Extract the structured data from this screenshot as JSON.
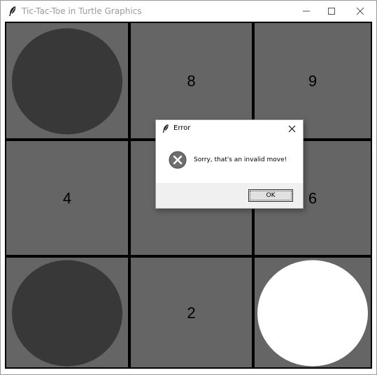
{
  "window": {
    "title": "Tic-Tac-Toe in Turtle Graphics",
    "icon": "feather-icon"
  },
  "board": {
    "cells": [
      {
        "row": 0,
        "col": 0,
        "label": "",
        "mark": "dark-circle"
      },
      {
        "row": 0,
        "col": 1,
        "label": "8",
        "mark": null
      },
      {
        "row": 0,
        "col": 2,
        "label": "9",
        "mark": null
      },
      {
        "row": 1,
        "col": 0,
        "label": "4",
        "mark": null
      },
      {
        "row": 1,
        "col": 1,
        "label": "",
        "mark": null
      },
      {
        "row": 1,
        "col": 2,
        "label": "6",
        "mark": null
      },
      {
        "row": 2,
        "col": 0,
        "label": "",
        "mark": "dark-circle"
      },
      {
        "row": 2,
        "col": 1,
        "label": "2",
        "mark": null
      },
      {
        "row": 2,
        "col": 2,
        "label": "",
        "mark": "white-circle"
      }
    ],
    "colors": {
      "background": "#656565",
      "grid": "#000000",
      "dark_circle": "#383838",
      "white_circle": "#ffffff"
    }
  },
  "dialog": {
    "title": "Error",
    "message": "Sorry, that's an invalid move!",
    "ok_label": "OK",
    "icon": "error-icon"
  }
}
